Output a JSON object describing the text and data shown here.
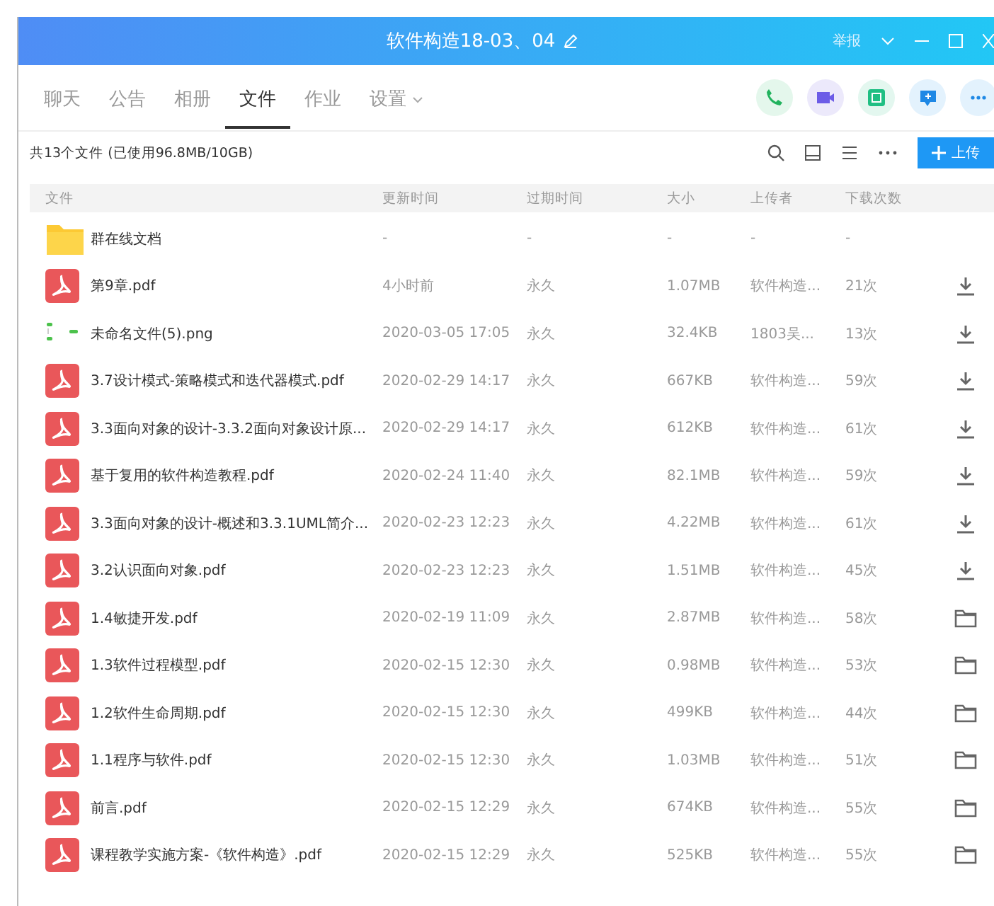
{
  "window": {
    "title": "软件构造18-03、04",
    "report": "举报"
  },
  "tabs": [
    {
      "label": "聊天",
      "selected": false
    },
    {
      "label": "公告",
      "selected": false
    },
    {
      "label": "相册",
      "selected": false
    },
    {
      "label": "文件",
      "selected": true
    },
    {
      "label": "作业",
      "selected": false
    },
    {
      "label": "设置",
      "selected": false,
      "dropdown": true
    }
  ],
  "summary": "共13个文件 (已使用96.8MB/10GB)",
  "upload_button": "上传",
  "table": {
    "columns": [
      "文件",
      "更新时间",
      "过期时间",
      "大小",
      "上传者",
      "下载次数"
    ],
    "rows": [
      {
        "kind": "folder",
        "name": "群在线文档",
        "updated": "-",
        "expires": "-",
        "size": "-",
        "uploader": "-",
        "downloads": "-"
      },
      {
        "kind": "pdf",
        "name": "第9章.pdf",
        "updated": "4小时前",
        "expires": "永久",
        "size": "1.07MB",
        "uploader": "软件构造...",
        "downloads": "21次",
        "action": {
          "kind": "download"
        }
      },
      {
        "kind": "image",
        "name": "未命名文件(5).png",
        "updated": "2020-03-05 17:05",
        "expires": "永久",
        "size": "32.4KB",
        "uploader": "1803吴...",
        "downloads": "13次",
        "action": {
          "kind": "download"
        }
      },
      {
        "kind": "pdf",
        "name": "3.7设计模式-策略模式和迭代器模式.pdf",
        "updated": "2020-02-29 14:17",
        "expires": "永久",
        "size": "667KB",
        "uploader": "软件构造...",
        "downloads": "59次",
        "action": {
          "kind": "download"
        }
      },
      {
        "kind": "pdf",
        "name": "3.3面向对象的设计-3.3.2面向对象设计原...",
        "updated": "2020-02-29 14:17",
        "expires": "永久",
        "size": "612KB",
        "uploader": "软件构造...",
        "downloads": "61次",
        "action": {
          "kind": "download"
        }
      },
      {
        "kind": "pdf",
        "name": "基于复用的软件构造教程.pdf",
        "updated": "2020-02-24 11:40",
        "expires": "永久",
        "size": "82.1MB",
        "uploader": "软件构造...",
        "downloads": "59次",
        "action": {
          "kind": "download"
        }
      },
      {
        "kind": "pdf",
        "name": "3.3面向对象的设计-概述和3.3.1UML简介...",
        "updated": "2020-02-23 12:23",
        "expires": "永久",
        "size": "4.22MB",
        "uploader": "软件构造...",
        "downloads": "61次",
        "action": {
          "kind": "download"
        }
      },
      {
        "kind": "pdf",
        "name": "3.2认识面向对象.pdf",
        "updated": "2020-02-23 12:23",
        "expires": "永久",
        "size": "1.51MB",
        "uploader": "软件构造...",
        "downloads": "45次",
        "action": {
          "kind": "download"
        }
      },
      {
        "kind": "pdf",
        "name": "1.4敏捷开发.pdf",
        "updated": "2020-02-19 11:09",
        "expires": "永久",
        "size": "2.87MB",
        "uploader": "软件构造...",
        "downloads": "58次",
        "action": {
          "kind": "folder"
        }
      },
      {
        "kind": "pdf",
        "name": "1.3软件过程模型.pdf",
        "updated": "2020-02-15 12:30",
        "expires": "永久",
        "size": "0.98MB",
        "uploader": "软件构造...",
        "downloads": "53次",
        "action": {
          "kind": "folder"
        }
      },
      {
        "kind": "pdf",
        "name": "1.2软件生命周期.pdf",
        "updated": "2020-02-15 12:30",
        "expires": "永久",
        "size": "499KB",
        "uploader": "软件构造...",
        "downloads": "44次",
        "action": {
          "kind": "folder"
        }
      },
      {
        "kind": "pdf",
        "name": "1.1程序与软件.pdf",
        "updated": "2020-02-15 12:30",
        "expires": "永久",
        "size": "1.03MB",
        "uploader": "软件构造...",
        "downloads": "51次",
        "action": {
          "kind": "folder"
        }
      },
      {
        "kind": "pdf",
        "name": "前言.pdf",
        "updated": "2020-02-15 12:29",
        "expires": "永久",
        "size": "674KB",
        "uploader": "软件构造...",
        "downloads": "55次",
        "action": {
          "kind": "folder"
        }
      },
      {
        "kind": "pdf",
        "name": "课程教学实施方案-《软件构造》.pdf",
        "updated": "2020-02-15 12:29",
        "expires": "永久",
        "size": "525KB",
        "uploader": "软件构造...",
        "downloads": "55次",
        "action": {
          "kind": "folder"
        }
      }
    ]
  }
}
